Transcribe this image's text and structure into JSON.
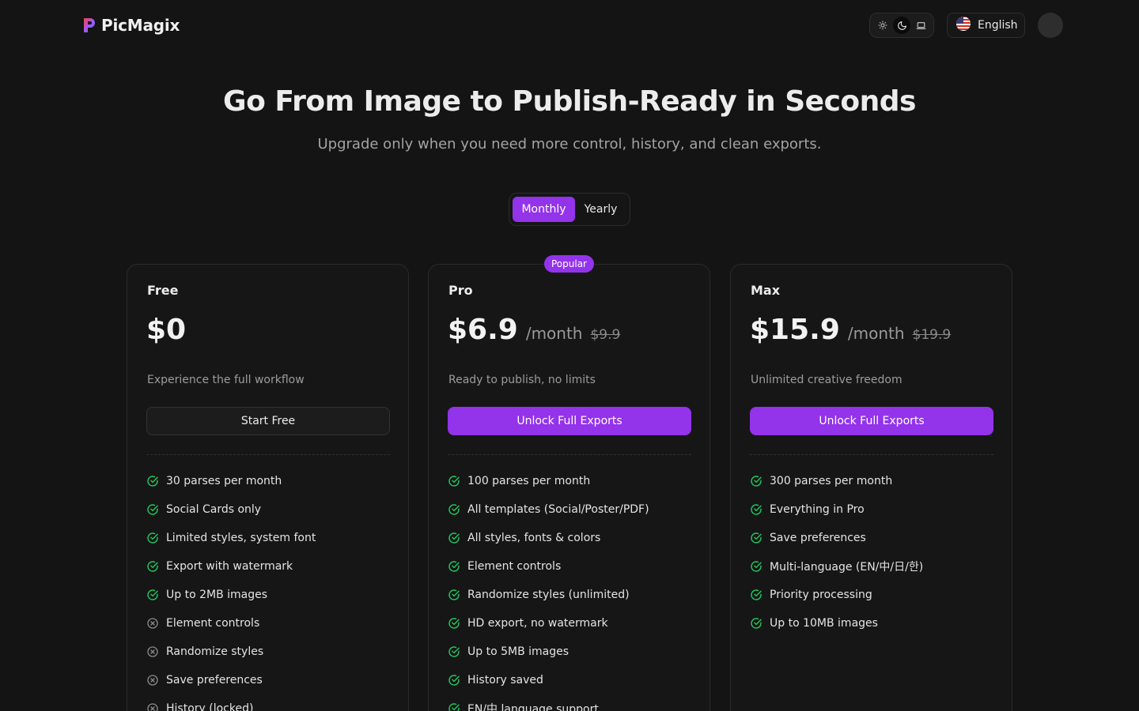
{
  "header": {
    "brand": "PicMagix",
    "language": "English",
    "theme_options": [
      "sun-icon",
      "moon-icon",
      "laptop-icon"
    ],
    "theme_active": "moon-icon"
  },
  "hero": {
    "title": "Go From Image to Publish-Ready in Seconds",
    "subtitle": "Upgrade only when you need more control, history, and clean exports."
  },
  "billing": {
    "monthly": "Monthly",
    "yearly": "Yearly",
    "selected": "Monthly"
  },
  "colors": {
    "accent": "#9333ea",
    "check": "#22c55e",
    "cross": "#8a8a8a",
    "background": "#141414"
  },
  "plans": [
    {
      "name": "Free",
      "price": "$0",
      "period": "",
      "original_price": "",
      "description": "Experience the full workflow",
      "cta": "Start Free",
      "features": [
        {
          "text": "30 parses per month",
          "included": true
        },
        {
          "text": "Social Cards only",
          "included": true
        },
        {
          "text": "Limited styles, system font",
          "included": true
        },
        {
          "text": "Export with watermark",
          "included": true
        },
        {
          "text": "Up to 2MB images",
          "included": true
        },
        {
          "text": "Element controls",
          "included": false
        },
        {
          "text": "Randomize styles",
          "included": false
        },
        {
          "text": "Save preferences",
          "included": false
        },
        {
          "text": "History (locked)",
          "included": false
        }
      ]
    },
    {
      "name": "Pro",
      "badge": "Popular",
      "price": "$6.9",
      "period": "/month",
      "original_price": "$9.9",
      "description": "Ready to publish, no limits",
      "cta": "Unlock Full Exports",
      "features": [
        {
          "text": "100 parses per month",
          "included": true
        },
        {
          "text": "All templates (Social/Poster/PDF)",
          "included": true
        },
        {
          "text": "All styles, fonts & colors",
          "included": true
        },
        {
          "text": "Element controls",
          "included": true
        },
        {
          "text": "Randomize styles (unlimited)",
          "included": true
        },
        {
          "text": "HD export, no watermark",
          "included": true
        },
        {
          "text": "Up to 5MB images",
          "included": true
        },
        {
          "text": "History saved",
          "included": true
        },
        {
          "text": "EN/中 language support",
          "included": true
        }
      ]
    },
    {
      "name": "Max",
      "price": "$15.9",
      "period": "/month",
      "original_price": "$19.9",
      "description": "Unlimited creative freedom",
      "cta": "Unlock Full Exports",
      "features": [
        {
          "text": "300 parses per month",
          "included": true
        },
        {
          "text": "Everything in Pro",
          "included": true
        },
        {
          "text": "Save preferences",
          "included": true
        },
        {
          "text": "Multi-language (EN/中/日/한)",
          "included": true
        },
        {
          "text": "Priority processing",
          "included": true
        },
        {
          "text": "Up to 10MB images",
          "included": true
        }
      ]
    }
  ]
}
